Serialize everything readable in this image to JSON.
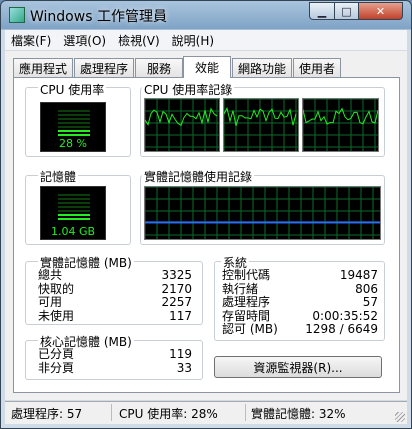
{
  "window": {
    "title": "Windows 工作管理員"
  },
  "menu": [
    "檔案(F)",
    "選項(O)",
    "檢視(V)",
    "說明(H)"
  ],
  "tabs": [
    "應用程式",
    "處理程序",
    "服務",
    "效能",
    "網路功能",
    "使用者"
  ],
  "active_tab": "效能",
  "cpu": {
    "label": "CPU 使用率",
    "value": "28 %",
    "percent": 28
  },
  "cpu_history": {
    "label": "CPU 使用率記錄"
  },
  "memory": {
    "label": "記憶體",
    "value": "1.04 GB",
    "fraction": 0.32
  },
  "memory_history": {
    "label": "實體記憶體使用記錄"
  },
  "physical_memory": {
    "title": "實體記憶體 (MB)",
    "rows": [
      {
        "label": "總共",
        "value": "3325"
      },
      {
        "label": "快取的",
        "value": "2170"
      },
      {
        "label": "可用",
        "value": "2257"
      },
      {
        "label": "未使用",
        "value": "117"
      }
    ]
  },
  "kernel_memory": {
    "title": "核心記憶體 (MB)",
    "rows": [
      {
        "label": "已分頁",
        "value": "119"
      },
      {
        "label": "非分頁",
        "value": "33"
      }
    ]
  },
  "system": {
    "title": "系統",
    "rows": [
      {
        "label": "控制代碼",
        "value": "19487"
      },
      {
        "label": "執行緒",
        "value": "806"
      },
      {
        "label": "處理程序",
        "value": "57"
      },
      {
        "label": "存留時間",
        "value": "0:00:35:52"
      },
      {
        "label": "認可 (MB)",
        "value": "1298 / 6649"
      }
    ]
  },
  "resource_monitor_button": "資源監視器(R)...",
  "status": {
    "processes": "處理程序: 57",
    "cpu": "CPU 使用率: 28%",
    "memory": "實體記憶體: 32%"
  },
  "colors": {
    "graph_line": "#22ee22",
    "memory_line": "#2b6bff",
    "grid": "#0b6b2b"
  }
}
